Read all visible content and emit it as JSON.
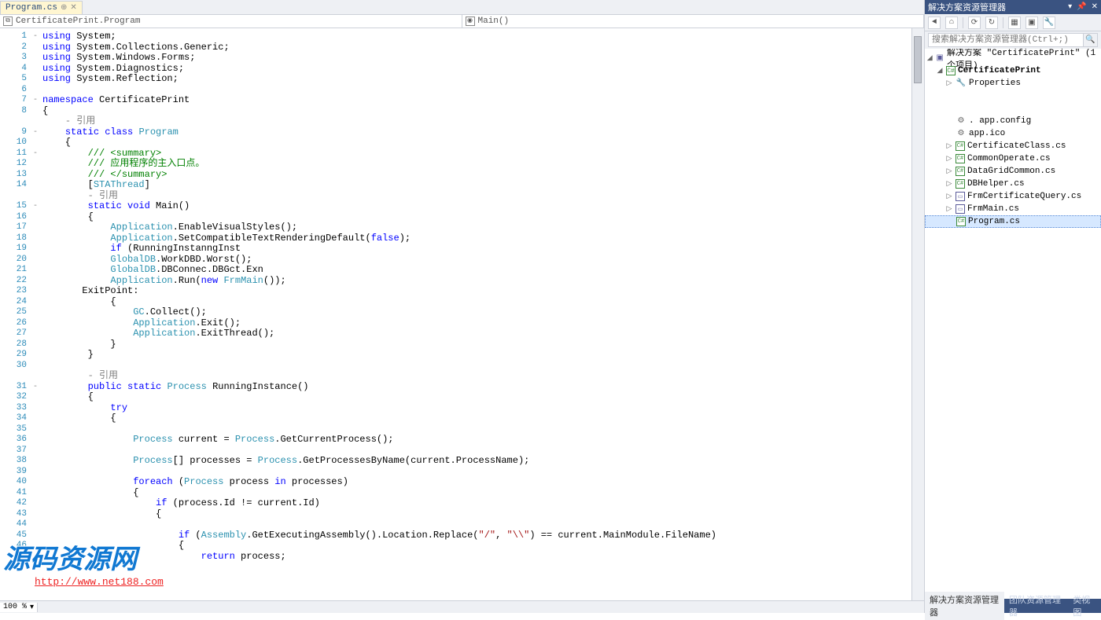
{
  "tabs": {
    "file": "Program.cs"
  },
  "nav": {
    "left": "CertificatePrint.Program",
    "right": "Main()"
  },
  "zoom": "100 %",
  "solution_explorer": {
    "title": "解决方案资源管理器",
    "search_placeholder": "搜索解决方案资源管理器(Ctrl+;)",
    "solution": "解决方案 \"CertificatePrint\" (1 个项目)",
    "project": "CertificatePrint",
    "properties": "Properties",
    "items": [
      {
        "icon": "cfg",
        "name": ". app.config"
      },
      {
        "icon": "cfg",
        "name": "app.ico"
      },
      {
        "icon": "cs",
        "name": "CertificateClass.cs",
        "expand": true
      },
      {
        "icon": "cs",
        "name": "CommonOperate.cs",
        "expand": true
      },
      {
        "icon": "cs",
        "name": "DataGridCommon.cs",
        "expand": true
      },
      {
        "icon": "cs",
        "name": "DBHelper.cs",
        "expand": true
      },
      {
        "icon": "frm",
        "name": "FrmCertificateQuery.cs",
        "expand": true
      },
      {
        "icon": "frm",
        "name": "FrmMain.cs",
        "expand": true
      },
      {
        "icon": "cs",
        "name": "Program.cs",
        "selected": true
      }
    ]
  },
  "bottom_tabs": [
    "解决方案资源管理器",
    "团队资源管理器",
    "类视图"
  ],
  "watermark": {
    "title": "源码资源网",
    "url": "http://www.net188.com"
  },
  "code": [
    {
      "n": 1,
      "f": "-",
      "t": "<kw>using</kw> System;"
    },
    {
      "n": 2,
      "t": "<kw>using</kw> System.Collections.Generic;"
    },
    {
      "n": 3,
      "t": "<kw>using</kw> System.Windows.Forms;"
    },
    {
      "n": 4,
      "t": "<kw>using</kw> System.Diagnostics;"
    },
    {
      "n": 5,
      "t": "<kw>using</kw> System.Reflection;"
    },
    {
      "n": 6,
      "t": ""
    },
    {
      "n": 7,
      "f": "-",
      "t": "<kw>namespace</kw> CertificatePrint"
    },
    {
      "n": 8,
      "t": "{"
    },
    {
      "n": "",
      "t": "    <reg>- 引用</reg>"
    },
    {
      "n": 9,
      "f": "-",
      "t": "    <kw>static</kw> <kw>class</kw> <typ>Program</typ>"
    },
    {
      "n": 10,
      "t": "    {"
    },
    {
      "n": 11,
      "f": "-",
      "t": "        <cmt>/// &lt;summary&gt;</cmt>"
    },
    {
      "n": 12,
      "t": "        <cmt>/// 应用程序的主入口点。</cmt>"
    },
    {
      "n": 13,
      "t": "        <cmt>/// &lt;/summary&gt;</cmt>"
    },
    {
      "n": 14,
      "t": "        [<typ>STAThread</typ>]"
    },
    {
      "n": "",
      "t": "        <reg>- 引用</reg>"
    },
    {
      "n": 15,
      "f": "-",
      "t": "        <kw>static</kw> <kw>void</kw> Main()"
    },
    {
      "n": 16,
      "t": "        {"
    },
    {
      "n": 17,
      "t": "            <typ>Application</typ>.EnableVisualStyles();"
    },
    {
      "n": 18,
      "t": "            <typ>Application</typ>.SetCompatibleTextRenderingDefault(<kw>false</kw>);"
    },
    {
      "n": 19,
      "t": "            <kw>if</kw> (RunningInstanngInst"
    },
    {
      "n": 20,
      "t": "            <typ>GlobalDB</typ>.WorkDBD.Worst();"
    },
    {
      "n": 21,
      "t": "            <typ>GlobalDB</typ>.DBConnec.DBGct.Exn"
    },
    {
      "n": 22,
      "t": "            <typ>Application</typ>.Run(<kw>new</kw> <typ>FrmMain</typ>());"
    },
    {
      "n": 23,
      "t": "       ExitPoint:"
    },
    {
      "n": 24,
      "t": "            {"
    },
    {
      "n": 25,
      "t": "                <typ>GC</typ>.Collect();"
    },
    {
      "n": 26,
      "t": "                <typ>Application</typ>.Exit();"
    },
    {
      "n": 27,
      "t": "                <typ>Application</typ>.ExitThread();"
    },
    {
      "n": 28,
      "t": "            }"
    },
    {
      "n": 29,
      "t": "        }"
    },
    {
      "n": 30,
      "t": ""
    },
    {
      "n": "",
      "t": "        <reg>- 引用</reg>"
    },
    {
      "n": 31,
      "f": "-",
      "t": "        <kw>public</kw> <kw>static</kw> <typ>Process</typ> RunningInstance()"
    },
    {
      "n": 32,
      "t": "        {"
    },
    {
      "n": 33,
      "t": "            <kw>try</kw>"
    },
    {
      "n": 34,
      "t": "            {"
    },
    {
      "n": 35,
      "t": ""
    },
    {
      "n": 36,
      "t": "                <typ>Process</typ> current = <typ>Process</typ>.GetCurrentProcess();"
    },
    {
      "n": 37,
      "t": ""
    },
    {
      "n": 38,
      "t": "                <typ>Process</typ>[] processes = <typ>Process</typ>.GetProcessesByName(current.ProcessName);"
    },
    {
      "n": 39,
      "t": ""
    },
    {
      "n": 40,
      "t": "                <kw>foreach</kw> (<typ>Process</typ> process <kw>in</kw> processes)"
    },
    {
      "n": 41,
      "t": "                {"
    },
    {
      "n": 42,
      "t": "                    <kw>if</kw> (process.Id != current.Id)"
    },
    {
      "n": 43,
      "t": "                    {"
    },
    {
      "n": 44,
      "t": ""
    },
    {
      "n": 45,
      "t": "                        <kw>if</kw> (<typ>Assembly</typ>.GetExecutingAssembly().Location.Replace(<str>\"/\"</str>, <str>\"\\\\\"</str>) == current.MainModule.FileName)"
    },
    {
      "n": 46,
      "t": "                        {"
    },
    {
      "n": 47,
      "t": "                            <kw>return</kw> process;"
    }
  ]
}
